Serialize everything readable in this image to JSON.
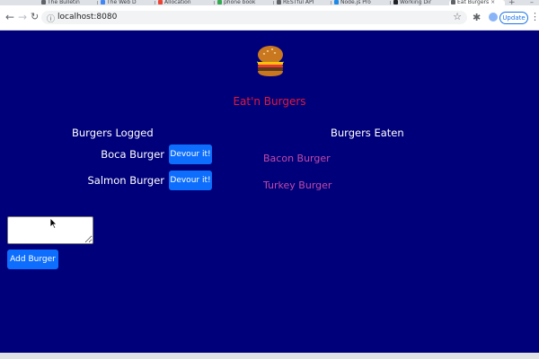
{
  "browser": {
    "tabs": [
      {
        "label": "The Bulletin",
        "color": "#5f6368"
      },
      {
        "label": "The Web D",
        "color": "#4285f4"
      },
      {
        "label": "Allocation",
        "color": "#ea4335"
      },
      {
        "label": "phone book",
        "color": "#34a853"
      },
      {
        "label": "RESTful API",
        "color": "#5f6368"
      },
      {
        "label": "Node.js Pro",
        "color": "#1e88e5"
      },
      {
        "label": "Working Dir",
        "color": "#202124"
      },
      {
        "label": "Eat Burgers",
        "color": "#5f6368"
      }
    ],
    "active_tab_index": 7,
    "url": "localhost:8080",
    "update_label": "Update"
  },
  "page": {
    "title": "Eat'n Burgers",
    "logged_heading": "Burgers Logged",
    "eaten_heading": "Burgers Eaten",
    "logged_burgers": [
      {
        "name": "Boca Burger",
        "button": "Devour it!"
      },
      {
        "name": "Salmon Burger",
        "button": "Devour it!"
      }
    ],
    "eaten_burgers": [
      "Bacon Burger",
      "Turkey Burger"
    ],
    "input_value": "",
    "add_button": "Add Burger"
  },
  "colors": {
    "background": "#00007a",
    "title": "#e0193a",
    "eaten_text": "#c24aa8",
    "button": "#0d6efd"
  }
}
